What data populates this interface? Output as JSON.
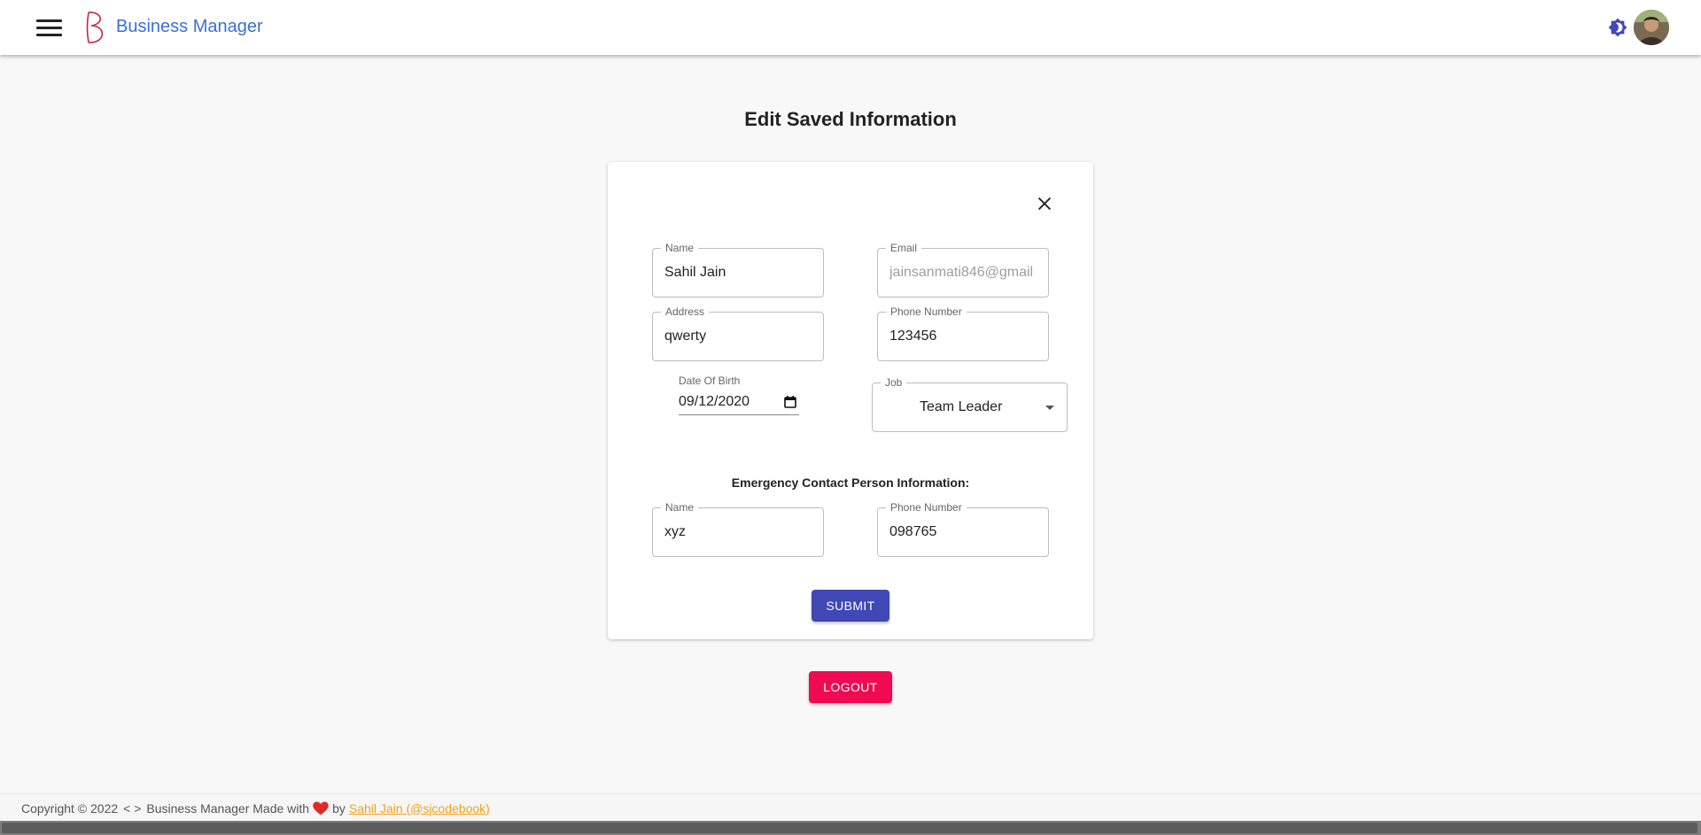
{
  "header": {
    "brand": "Business Manager",
    "menu_icon": "hamburger-menu-icon",
    "logo_icon": "business-manager-logo-icon",
    "theme_icon": "theme-toggle-icon",
    "avatar_icon": "user-avatar"
  },
  "page": {
    "title": "Edit Saved Information"
  },
  "form": {
    "close_icon": "close-icon",
    "name": {
      "label": "Name",
      "value": "Sahil Jain"
    },
    "email": {
      "label": "Email",
      "value": "jainsanmati846@gmail"
    },
    "address": {
      "label": "Address",
      "value": "qwerty"
    },
    "phone": {
      "label": "Phone Number",
      "value": "123456"
    },
    "dob": {
      "label": "Date Of Birth",
      "value": "09/12/2020"
    },
    "job": {
      "label": "Job",
      "value": "Team Leader"
    },
    "emergency_title": "Emergency Contact Person Information:",
    "emergency_name": {
      "label": "Name",
      "value": "xyz"
    },
    "emergency_phone": {
      "label": "Phone Number",
      "value": "098765"
    },
    "submit_label": "SUBMIT"
  },
  "logout_label": "LOGOUT",
  "footer": {
    "copyright": "Copyright © 2022",
    "code_symbol": "< >",
    "made_with": "Business Manager Made with",
    "by": "by",
    "author_link": "Sahil Jain (@sjcodebook)"
  },
  "colors": {
    "brand": "#3a6fd8",
    "primary": "#3f48b5",
    "logout": "#ef0a52",
    "link": "#f0a21b"
  }
}
